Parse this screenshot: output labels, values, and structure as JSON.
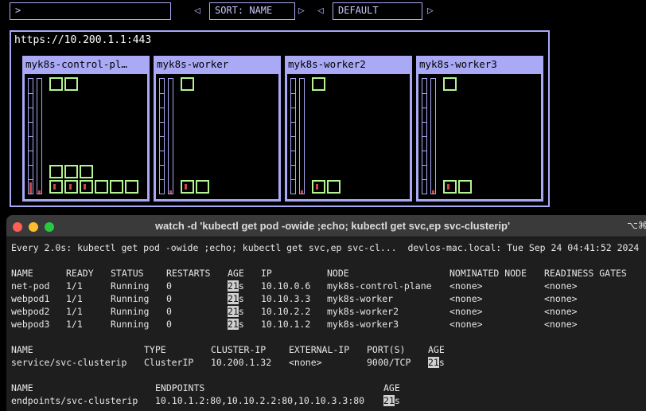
{
  "dashboard": {
    "search_text": ">",
    "sort_label": "SORT: NAME",
    "namespace_label": "DEFAULT",
    "cluster_url": "https://10.200.1.1:443",
    "nodes": [
      {
        "name": "myk8s-control-pl…"
      },
      {
        "name": "myk8s-worker"
      },
      {
        "name": "myk8s-worker2"
      },
      {
        "name": "myk8s-worker3"
      }
    ]
  },
  "terminal": {
    "title": "watch -d 'kubectl get pod -owide ;echo; kubectl get svc,ep svc-clusterip'",
    "shortcut": "⌥⌘",
    "watch_line": "Every 2.0s: kubectl get pod -owide ;echo; kubectl get svc,ep svc-cl...  devlos-mac.local: Tue Sep 24 04:41:52 2024",
    "pods": {
      "headers": [
        "NAME",
        "READY",
        "STATUS",
        "RESTARTS",
        "AGE",
        "IP",
        "NODE",
        "NOMINATED NODE",
        "READINESS GATES"
      ],
      "rows": [
        [
          "net-pod",
          "1/1",
          "Running",
          "0",
          "21",
          "s",
          "10.10.0.6",
          "myk8s-control-plane",
          "<none>",
          "<none>"
        ],
        [
          "webpod1",
          "1/1",
          "Running",
          "0",
          "21",
          "s",
          "10.10.3.3",
          "myk8s-worker",
          "<none>",
          "<none>"
        ],
        [
          "webpod2",
          "1/1",
          "Running",
          "0",
          "21",
          "s",
          "10.10.2.2",
          "myk8s-worker2",
          "<none>",
          "<none>"
        ],
        [
          "webpod3",
          "1/1",
          "Running",
          "0",
          "21",
          "s",
          "10.10.1.2",
          "myk8s-worker3",
          "<none>",
          "<none>"
        ]
      ]
    },
    "services": {
      "headers": [
        "NAME",
        "TYPE",
        "CLUSTER-IP",
        "EXTERNAL-IP",
        "PORT(S)",
        "AGE"
      ],
      "row": [
        "service/svc-clusterip",
        "ClusterIP",
        "10.200.1.32",
        "<none>",
        "9000/TCP",
        "21",
        "s"
      ]
    },
    "endpoints": {
      "headers": [
        "NAME",
        "ENDPOINTS",
        "AGE"
      ],
      "row": [
        "endpoints/svc-clusterip",
        "10.10.1.2:80,10.10.2.2:80,10.10.3.3:80",
        "21",
        "s"
      ]
    }
  }
}
